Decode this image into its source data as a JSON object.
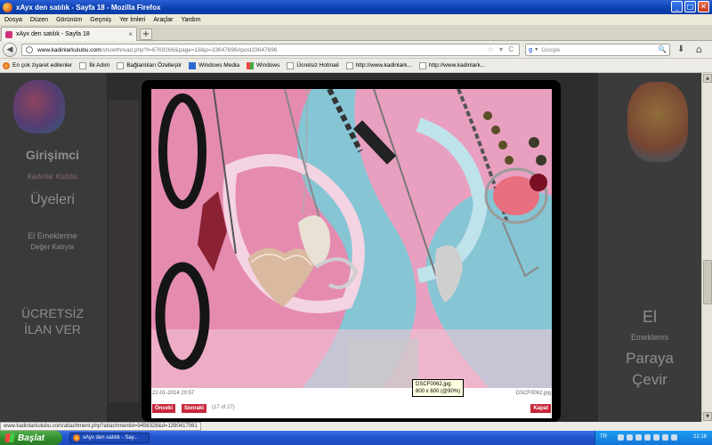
{
  "window": {
    "title": "xAyx den satılık - Sayfa 18 - Mozilla Firefox",
    "minimize": "_",
    "maximize": "□",
    "close": "✕"
  },
  "menu": [
    "Dosya",
    "Düzen",
    "Görünüm",
    "Geçmiş",
    "Yer İmleri",
    "Araçlar",
    "Yardım"
  ],
  "tab": {
    "label": "xAyx den satılık - Sayfa 18",
    "close": "×",
    "new_tab": "+"
  },
  "nav": {
    "back": "◀",
    "url_host": "www.kadinlarkulubu.com",
    "url_rest": "/showthread.php?t=6769266&page=18&p=33647696#post33647696",
    "url_icons": "☆ ▾ C",
    "search_engine": "g",
    "search_placeholder": "Google",
    "search_icon": "🔍",
    "downloads": "⬇",
    "home": "⌂"
  },
  "bookmarks": [
    "En çok ziyaret edilenler",
    "İlk Adım",
    "Bağlantıları Özelleştir",
    "Windows Media",
    "Windows",
    "Ücretsiz Hotmail",
    "http://www.kadinlark...",
    "http://www.kadinlark..."
  ],
  "sidebar_left": {
    "t1": "Girişimci",
    "t2": "Kadınlar Kulübü",
    "t3": "Üyeleri",
    "t4": "El Emeklerine",
    "t5": "Değer Katıyor",
    "t6": "ÜCRETSİZ",
    "t7": "İLAN VER"
  },
  "sidebar_right": {
    "t1": "El",
    "t2": "Emeklerini",
    "t3": "Paraya",
    "t4": "Çevir"
  },
  "lightbox": {
    "tooltip_line1": "DSCF0062.jpg:",
    "tooltip_line2": "800 x 600 (@90%)",
    "date": "22-01-2014 20:57",
    "filename": "DSCF0062.jpg",
    "prev": "Önceki",
    "next": "Sonraki",
    "count": "(17 of 27)",
    "close": "Kapat"
  },
  "status": {
    "url": "www.kadinlarkulubu.com/attachment.php?attachmentid=9456328&d=1390417061"
  },
  "taskbar": {
    "start": "Başlat",
    "task": "xAyx den satılık - Say...",
    "lang": "TR",
    "time": "22:16"
  },
  "colors": {
    "titlebar": "#0a3fae",
    "overlay_bg": "#2d2d2d",
    "lightbox_button": "#c8283b",
    "start_button": "#2f8a2a"
  }
}
